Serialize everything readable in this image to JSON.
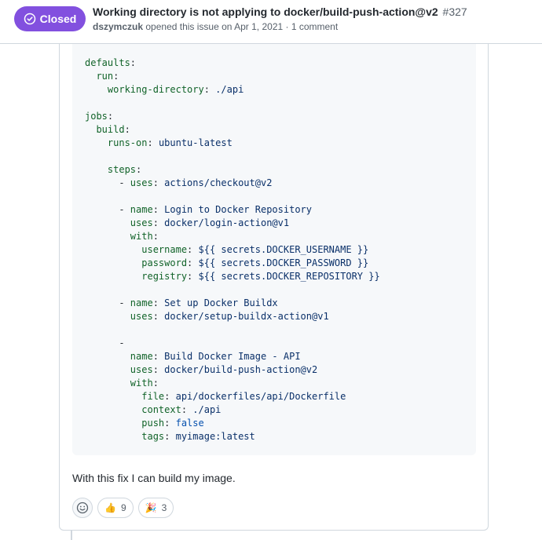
{
  "header": {
    "state_label": "Closed",
    "title": "Working directory is not applying to docker/build-push-action@v2",
    "number": "#327",
    "author": "dszymczuk",
    "opened_text": "opened this issue on Apr 1, 2021 · 1 comment"
  },
  "code": {
    "lines": [
      [
        {
          "t": "defaults",
          "c": "k"
        },
        {
          "t": ":",
          "c": "p"
        }
      ],
      [
        {
          "t": "  run",
          "c": "k"
        },
        {
          "t": ":",
          "c": "p"
        }
      ],
      [
        {
          "t": "    working-directory",
          "c": "k"
        },
        {
          "t": ": ",
          "c": "p"
        },
        {
          "t": "./api",
          "c": "v"
        }
      ],
      [],
      [
        {
          "t": "jobs",
          "c": "k"
        },
        {
          "t": ":",
          "c": "p"
        }
      ],
      [
        {
          "t": "  build",
          "c": "k"
        },
        {
          "t": ":",
          "c": "p"
        }
      ],
      [
        {
          "t": "    runs-on",
          "c": "k"
        },
        {
          "t": ": ",
          "c": "p"
        },
        {
          "t": "ubuntu-latest",
          "c": "v"
        }
      ],
      [],
      [
        {
          "t": "    steps",
          "c": "k"
        },
        {
          "t": ":",
          "c": "p"
        }
      ],
      [
        {
          "t": "      - ",
          "c": "p"
        },
        {
          "t": "uses",
          "c": "k"
        },
        {
          "t": ": ",
          "c": "p"
        },
        {
          "t": "actions/checkout@v2",
          "c": "v"
        }
      ],
      [],
      [
        {
          "t": "      - ",
          "c": "p"
        },
        {
          "t": "name",
          "c": "k"
        },
        {
          "t": ": ",
          "c": "p"
        },
        {
          "t": "Login to Docker Repository",
          "c": "v"
        }
      ],
      [
        {
          "t": "        uses",
          "c": "k"
        },
        {
          "t": ": ",
          "c": "p"
        },
        {
          "t": "docker/login-action@v1",
          "c": "v"
        }
      ],
      [
        {
          "t": "        with",
          "c": "k"
        },
        {
          "t": ":",
          "c": "p"
        }
      ],
      [
        {
          "t": "          username",
          "c": "k"
        },
        {
          "t": ": ",
          "c": "p"
        },
        {
          "t": "${{ secrets.DOCKER_USERNAME }}",
          "c": "v"
        }
      ],
      [
        {
          "t": "          password",
          "c": "k"
        },
        {
          "t": ": ",
          "c": "p"
        },
        {
          "t": "${{ secrets.DOCKER_PASSWORD }}",
          "c": "v"
        }
      ],
      [
        {
          "t": "          registry",
          "c": "k"
        },
        {
          "t": ": ",
          "c": "p"
        },
        {
          "t": "${{ secrets.DOCKER_REPOSITORY }}",
          "c": "v"
        }
      ],
      [],
      [
        {
          "t": "      - ",
          "c": "p"
        },
        {
          "t": "name",
          "c": "k"
        },
        {
          "t": ": ",
          "c": "p"
        },
        {
          "t": "Set up Docker Buildx",
          "c": "v"
        }
      ],
      [
        {
          "t": "        uses",
          "c": "k"
        },
        {
          "t": ": ",
          "c": "p"
        },
        {
          "t": "docker/setup-buildx-action@v1",
          "c": "v"
        }
      ],
      [],
      [
        {
          "t": "      -",
          "c": "p"
        }
      ],
      [
        {
          "t": "        name",
          "c": "k"
        },
        {
          "t": ": ",
          "c": "p"
        },
        {
          "t": "Build Docker Image - API",
          "c": "v"
        }
      ],
      [
        {
          "t": "        uses",
          "c": "k"
        },
        {
          "t": ": ",
          "c": "p"
        },
        {
          "t": "docker/build-push-action@v2",
          "c": "v"
        }
      ],
      [
        {
          "t": "        with",
          "c": "k"
        },
        {
          "t": ":",
          "c": "p"
        }
      ],
      [
        {
          "t": "          file",
          "c": "k"
        },
        {
          "t": ": ",
          "c": "p"
        },
        {
          "t": "api/dockerfiles/api/Dockerfile",
          "c": "v"
        }
      ],
      [
        {
          "t": "          context",
          "c": "k"
        },
        {
          "t": ": ",
          "c": "p"
        },
        {
          "t": "./api",
          "c": "v"
        }
      ],
      [
        {
          "t": "          push",
          "c": "k"
        },
        {
          "t": ": ",
          "c": "p"
        },
        {
          "t": "false",
          "c": "b"
        }
      ],
      [
        {
          "t": "          tags",
          "c": "k"
        },
        {
          "t": ": ",
          "c": "p"
        },
        {
          "t": "myimage:latest",
          "c": "v"
        }
      ]
    ]
  },
  "comment": {
    "text": "With this fix I can build my image."
  },
  "reactions": [
    {
      "emoji": "👍",
      "count": "9",
      "name": "thumbs-up-reaction"
    },
    {
      "emoji": "🎉",
      "count": "3",
      "name": "hooray-reaction"
    }
  ],
  "colors": {
    "closed_badge": "#8250df",
    "yaml_key": "#116329",
    "yaml_value": "#0a3069",
    "yaml_boolean": "#0550ae"
  }
}
